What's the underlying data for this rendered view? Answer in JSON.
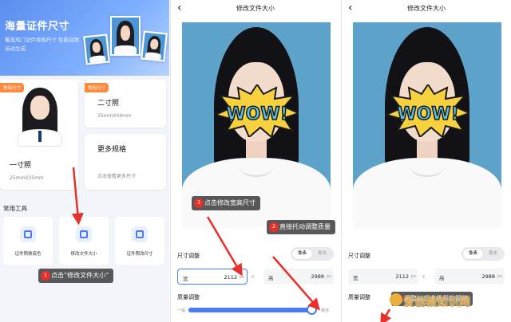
{
  "panel1": {
    "banner_title": "海量证件尺寸",
    "banner_sub": "覆盖热门证件规格尺寸 智能底图自动生成",
    "card1": {
      "tag": "常用尺寸",
      "name": "一寸照",
      "size": "25mmX35mm"
    },
    "card2": {
      "tag": "常用尺寸",
      "name": "二寸照",
      "size": "35mmX49mm"
    },
    "card3": {
      "name": "更多规格",
      "size": "点击查看更多尺寸"
    },
    "tools_title": "常用工具",
    "tools": [
      "证件照换底色",
      "修改文件大小",
      "证件照改尺寸"
    ],
    "annotation": {
      "num": "1",
      "text": "点击”修改文件大小“"
    }
  },
  "panel2": {
    "title": "修改文件大小",
    "size_title": "尺寸调整",
    "toggle": [
      "像素",
      "毫米"
    ],
    "width_label": "宽",
    "width_value": "2112",
    "height_label": "高",
    "height_value": "2988",
    "unit": "px",
    "times": "×",
    "quality_title": "质量调整",
    "slider_min": "一般",
    "slider_max": "最佳",
    "slider_value": 0.97,
    "annotation3": {
      "num": "3",
      "text": "点击修改宽高尺寸"
    },
    "annotation2": {
      "num": "2",
      "text": "直接托动调整质量"
    },
    "wow_text": "WOW!"
  },
  "panel3": {
    "title": "修改文件大小",
    "size_title": "尺寸调整",
    "toggle": [
      "像素",
      "毫米"
    ],
    "width_label": "宽",
    "width_value": "2112",
    "height_label": "高",
    "height_value": "2988",
    "unit": "px",
    "quality_title": "质量调整",
    "annotation4": {
      "num": "4",
      "text": "调整好后选择保存即可"
    },
    "watermark": "爱创根知识网"
  },
  "colors": {
    "accent": "#4a7bf0",
    "tag": "#ff8a3d",
    "annotation_red": "#e8302a",
    "photo_bg": "#5da3c9"
  }
}
